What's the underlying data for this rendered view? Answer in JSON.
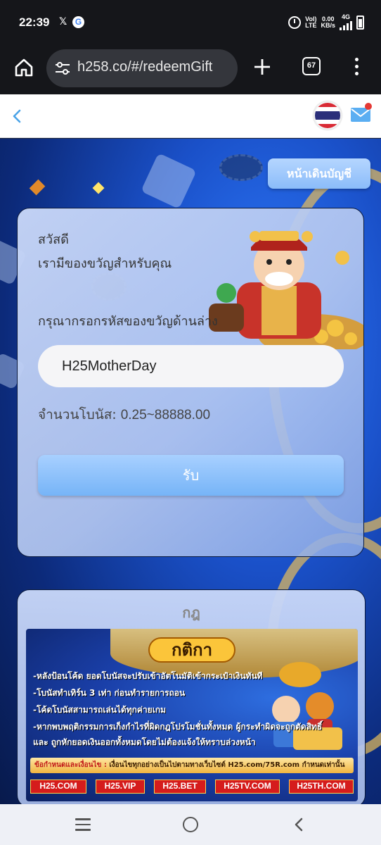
{
  "status_bar": {
    "time": "22:39",
    "x_glyph": "𝕏",
    "g_glyph": "G",
    "volte_top": "Vol)",
    "volte_bottom": "LTE",
    "speed_top": "0.00",
    "speed_bottom": "KB/s",
    "network": "4G"
  },
  "browser": {
    "url": "h258.co/#/redeemGift",
    "tab_count": "67"
  },
  "header": {
    "flag": "thai-flag",
    "has_notification": true
  },
  "account_button": {
    "label": "หน้าเดินบัญชี"
  },
  "redeem_card": {
    "greeting_line1": "สวัสดี",
    "greeting_line2": "เรามีของขวัญสำหรับคุณ",
    "instruction": "กรุณากรอกรหัสของขวัญด้านล่าง",
    "code_value": "H25MotherDay",
    "bonus_label": "จำนวนโบนัส:",
    "bonus_amount": "0.25~88888.00",
    "claim_label": "รับ"
  },
  "rules_card": {
    "title": "กฎ",
    "banner": {
      "title": "กติกา",
      "rules": [
        "-หลังป้อนโค้ด ยอดโบนัสจะปรับเข้าอัตโนมัติเข้ากระเป๋าเงินทันที",
        "-โบนัสทำเทิร์น 3 เท่า ก่อนทำรายการถอน",
        "-โค้ดโบนัสสามารถเล่นได้ทุกค่ายเกม",
        "-หากพบพฤติกรรมการเก็งกำไรที่ผิดกฎโปรโมชั่นทั้งหมด ผู้กระทำผิดจะถูกตัดสิทธิ์",
        "และ ถูกหักยอดเงินออกทั้งหมดโดยไม่ต้องแจ้งให้ทราบล่วงหน้า"
      ],
      "condition_prefix": "ข้อกำหนดและเงื่อนไข :",
      "condition_text": "เงื่อนไขทุกอย่างเป็นไปตามทางเว็บไซต์ H25.com/75R.com กำหนดเท่านั้น",
      "sites": [
        "H25.COM",
        "H25.VIP",
        "H25.BET",
        "H25TV.COM",
        "H25TH.COM"
      ]
    }
  },
  "colors": {
    "primary_blue": "#76b4f7",
    "header_bg": "#ffffff",
    "browser_bg": "#15161a",
    "site_red": "#d51c1c",
    "gold": "#fbc53a"
  }
}
